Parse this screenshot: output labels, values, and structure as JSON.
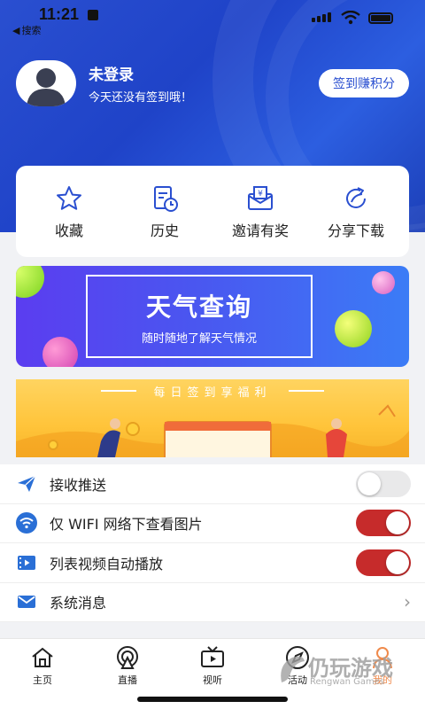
{
  "status_bar": {
    "time": "11:21",
    "back_label": "搜索"
  },
  "profile": {
    "name": "未登录",
    "subtitle": "今天还没有签到哦！",
    "checkin_button": "签到赚积分"
  },
  "quick_actions": [
    {
      "label": "收藏",
      "icon": "star-icon"
    },
    {
      "label": "历史",
      "icon": "history-icon"
    },
    {
      "label": "邀请有奖",
      "icon": "invite-icon"
    },
    {
      "label": "分享下载",
      "icon": "share-icon"
    }
  ],
  "banners": {
    "weather": {
      "title": "天气查询",
      "subtitle": "随时随地了解天气情况"
    },
    "welfare": {
      "title": "每日签到享福利"
    }
  },
  "settings": [
    {
      "label": "接收推送",
      "icon": "send-icon",
      "type": "toggle",
      "on": false
    },
    {
      "label": "仅 WIFI 网络下查看图片",
      "icon": "wifi-icon",
      "type": "toggle",
      "on": true
    },
    {
      "label": "列表视频自动播放",
      "icon": "video-icon",
      "type": "toggle",
      "on": true
    },
    {
      "label": "系统消息",
      "icon": "mail-icon",
      "type": "link"
    }
  ],
  "tabs": [
    {
      "label": "主页",
      "icon": "home-icon"
    },
    {
      "label": "直播",
      "icon": "live-icon"
    },
    {
      "label": "视听",
      "icon": "tv-icon"
    },
    {
      "label": "活动",
      "icon": "activity-icon"
    },
    {
      "label": "我的",
      "icon": "profile-icon",
      "active": true
    }
  ],
  "watermark": {
    "text": "仍玩游戏",
    "sub": "Rengwan Games"
  },
  "colors": {
    "brand_blue": "#2a4fd0",
    "toggle_on": "#c62b2b",
    "active_tab": "#f08a4b"
  }
}
